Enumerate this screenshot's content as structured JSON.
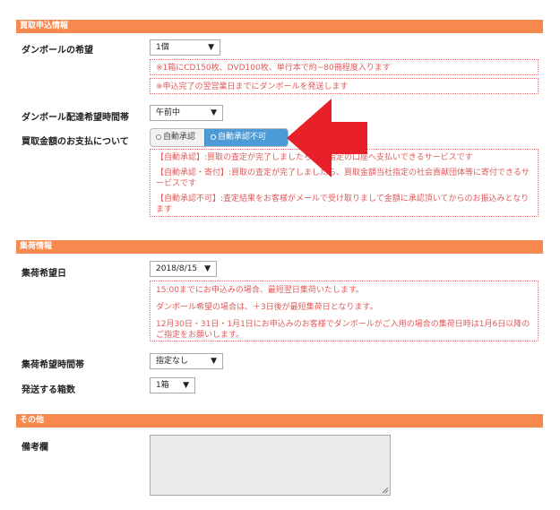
{
  "sections": {
    "purchase": "買取申込情報",
    "pickup": "集荷情報",
    "other": "その他"
  },
  "purchase": {
    "cardboard_label": "ダンボールの希望",
    "cardboard_value": "1個",
    "cardboard_notes": [
      "※1箱にCD150枚、DVD100枚、単行本で約~80冊程度入ります",
      "※申込完了の翌営業日までにダンボールを発送します"
    ],
    "delivery_time_label": "ダンボール配達希望時間帯",
    "delivery_time_value": "午前中",
    "payment_label": "買取金額のお支払について",
    "payment_option_auto": "自動承認",
    "payment_option_manual": "自動承認不可",
    "payment_notes": [
      "【自動承認】:買取の査定が完了しましたら、ご指定の口座へ支払いできるサービスです",
      "【自動承認・寄付】:買取の査定が完了しましたら、買取金額当社指定の社会貢献団体等に寄付できるサービスです",
      "【自動承認不可】:査定結果をお客様がメールで受け取りまして金額に承認頂いてからのお振込みとなります"
    ]
  },
  "pickup": {
    "date_label": "集荷希望日",
    "date_value": "2018/8/15",
    "date_notes": [
      "15:00までにお申込みの場合、最短翌日集荷いたします。",
      "ダンボール希望の場合は、＋3日後が最短集荷日となります。",
      "12月30日・31日・1月1日にお申込みのお客様でダンボールがご入用の場合の集荷日時は1月6日以降のご指定をお願いします。"
    ],
    "time_label": "集荷希望時間帯",
    "time_value": "指定なし",
    "boxes_label": "発送する箱数",
    "boxes_value": "1箱"
  },
  "other": {
    "remarks_label": "備考欄",
    "remarks_value": ""
  },
  "colors": {
    "section_header": "#f7894f",
    "note_text": "#e05a5a",
    "toggle_active": "#4d9bd6",
    "arrow": "#e8202a"
  },
  "icons": {
    "dropdown": "chevron-down-icon",
    "annotation": "arrow-left-icon"
  }
}
